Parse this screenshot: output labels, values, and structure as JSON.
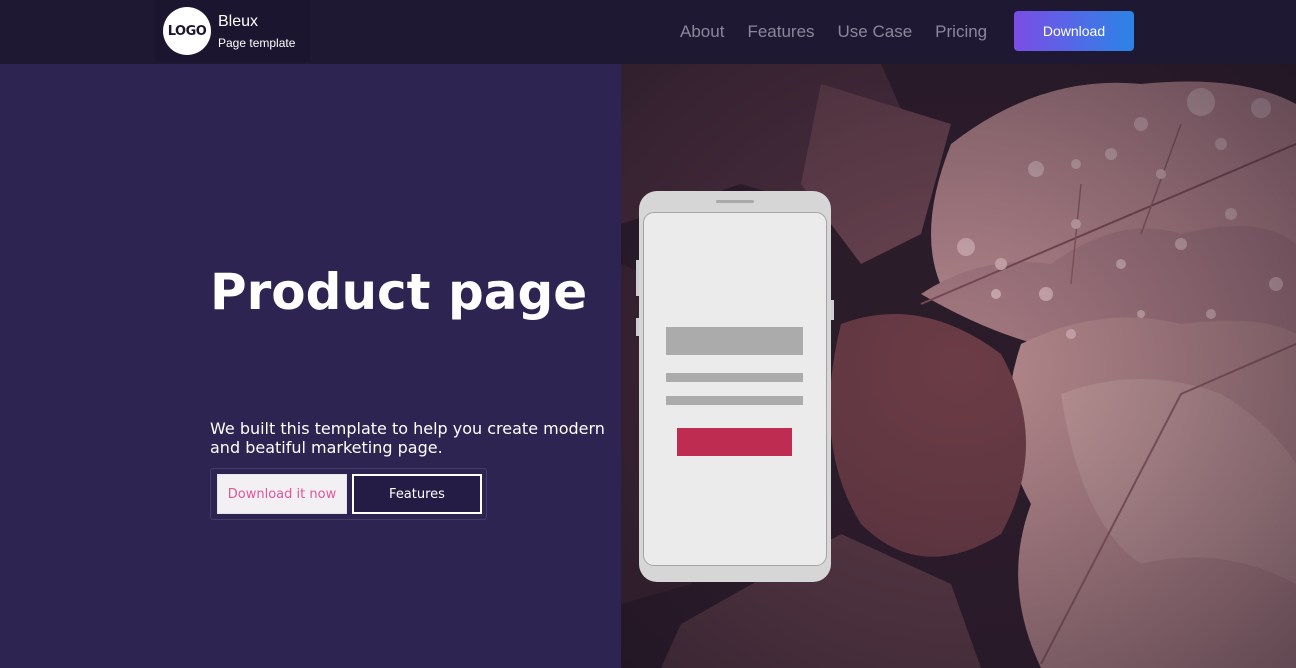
{
  "navbar": {
    "logo_text": "LOGO",
    "brand_name": "Bleux",
    "brand_subtitle": "Page template",
    "links": [
      {
        "label": "About"
      },
      {
        "label": "Features"
      },
      {
        "label": "Use Case"
      },
      {
        "label": "Pricing"
      }
    ],
    "download_label": "Download"
  },
  "hero": {
    "title": "Product page",
    "description": "We built this template to help you create modern and beatiful marketing page.",
    "primary_cta": "Download it now",
    "secondary_cta": "Features"
  },
  "colors": {
    "page_background": "#2e2451",
    "navbar_background": "#1f1833",
    "download_gradient_start": "#7b4de6",
    "download_gradient_end": "#2b84e6",
    "primary_cta_text": "#e0569a",
    "phone_button": "#be2c51"
  }
}
